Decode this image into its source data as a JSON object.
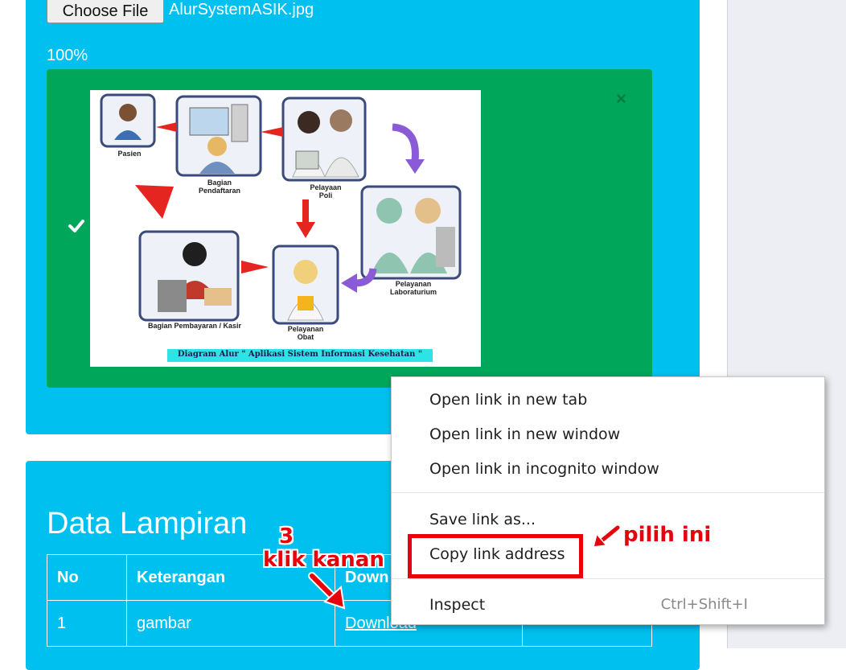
{
  "upload": {
    "choose_button": "Choose File",
    "file_name": "AlurSystemASIK.jpg",
    "progress": "100%",
    "progress_value": 1.0,
    "close_symbol": "×"
  },
  "diagram": {
    "labels": {
      "pasien": "Pasien",
      "pendaftaran": "Bagian Pendaftaran",
      "poli": "Pelayaan Poli",
      "laboratorium": "Pelayanan Laboraturium",
      "kasir": "Bagian Pembayaran / Kasir",
      "obat": "Pelayanan Obat"
    },
    "caption": "Diagram Alur \" Aplikasi Sistem Informasi Kesehatan \""
  },
  "section": {
    "title": "Data Lampiran"
  },
  "table": {
    "headers": [
      "No",
      "Keterangan",
      "Down"
    ],
    "rows": [
      {
        "no": "1",
        "keterangan": "gambar",
        "download": "Download"
      }
    ]
  },
  "context_menu": {
    "open_new_tab": "Open link in new tab",
    "open_new_window": "Open link in new window",
    "open_incognito": "Open link in incognito window",
    "save_link": "Save link as...",
    "copy_link": "Copy link address",
    "inspect": "Inspect",
    "inspect_shortcut": "Ctrl+Shift+I"
  },
  "annotations": {
    "step_number": "3",
    "step_text": "klik kanan",
    "choose_text": "pilih ini"
  },
  "colors": {
    "panel": "#00c0ef",
    "success": "#00a65a",
    "annotation": "#e8000b"
  }
}
